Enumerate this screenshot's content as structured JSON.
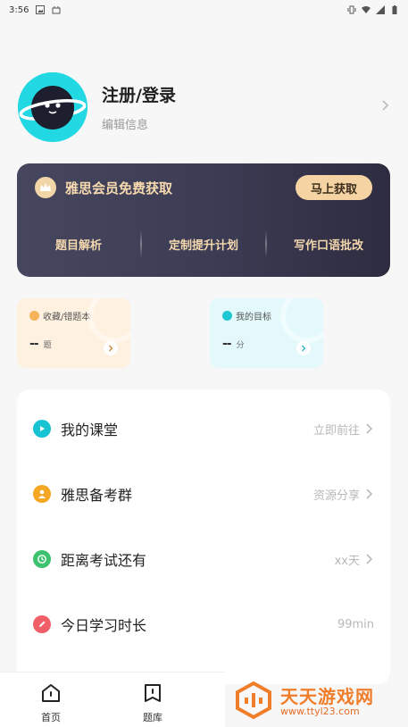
{
  "status_bar": {
    "time": "3:56",
    "icons": [
      "image-icon",
      "app-icon",
      "vibrate-icon",
      "wifi-icon",
      "signal-icon",
      "battery-icon"
    ]
  },
  "profile": {
    "name": "注册/登录",
    "subtitle": "编辑信息"
  },
  "vip": {
    "title": "雅思会员免费获取",
    "button": "马上获取",
    "features": [
      "题目解析",
      "定制提升计划",
      "写作口语批改"
    ]
  },
  "cards": {
    "favorites": {
      "title": "收藏/错题本",
      "value": "--",
      "unit": "题"
    },
    "goal": {
      "title": "我的目标",
      "value": "--",
      "unit": "分"
    }
  },
  "menu": {
    "items": [
      {
        "label": "我的课堂",
        "right": "立即前往",
        "color": "#17c3d2"
      },
      {
        "label": "雅思备考群",
        "right": "资源分享",
        "color": "#f5a623"
      },
      {
        "label": "距离考试还有",
        "right": "xx天",
        "color": "#3cc26e"
      },
      {
        "label": "今日学习时长",
        "right": "99min",
        "color": "#f05f67"
      }
    ]
  },
  "tabbar": {
    "tabs": [
      {
        "label": "首页"
      },
      {
        "label": "题库"
      }
    ]
  },
  "watermark": {
    "title": "天天游戏网",
    "url": "www.ttyl23.com"
  },
  "colors": {
    "accent_gold": "#f6d3a3",
    "vip_bg": "#3b3b53",
    "avatar": "#23d7e0"
  }
}
